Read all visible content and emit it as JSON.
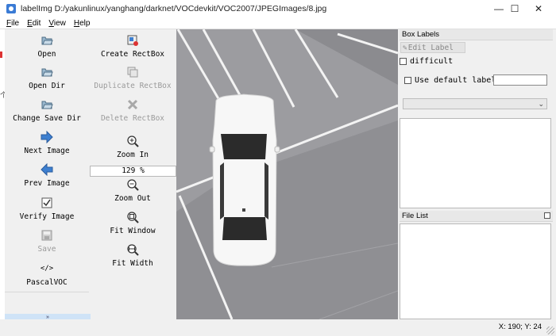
{
  "window": {
    "title": "labelImg D:/yakunlinux/yanghang/darknet/VOCdevkit/VOC2007/JPEGImages/8.jpg",
    "minimize": "—",
    "maximize": "☐",
    "close": "✕"
  },
  "menu": {
    "items": [
      "File",
      "Edit",
      "View",
      "Help"
    ]
  },
  "left_edge": {
    "mark": "个"
  },
  "toolbar": {
    "left_column": [
      {
        "label": "Open",
        "icon": "folder-open-icon",
        "enabled": true
      },
      {
        "label": "Open Dir",
        "icon": "folder-open-icon",
        "enabled": true
      },
      {
        "label": "Change Save Dir",
        "icon": "folder-open-icon",
        "enabled": true
      },
      {
        "label": "Next Image",
        "icon": "arrow-right-icon",
        "enabled": true
      },
      {
        "label": "Prev Image",
        "icon": "arrow-left-icon",
        "enabled": true
      },
      {
        "label": "Verify Image",
        "icon": "checkbox-icon",
        "enabled": true
      },
      {
        "label": "Save",
        "icon": "save-icon",
        "enabled": false
      },
      {
        "label": "PascalVOC",
        "icon": "code-icon",
        "enabled": true
      }
    ],
    "right_column": [
      {
        "label": "Create RectBox",
        "icon": "create-rect-icon",
        "enabled": true
      },
      {
        "label": "Duplicate RectBox",
        "icon": "duplicate-icon",
        "enabled": false
      },
      {
        "label": "Delete RectBox",
        "icon": "delete-icon",
        "enabled": false
      },
      {
        "label": "Zoom In",
        "icon": "zoom-in-icon",
        "enabled": true
      },
      {
        "label": "Zoom Out",
        "icon": "zoom-out-icon",
        "enabled": true
      },
      {
        "label": "Fit Window",
        "icon": "fit-window-icon",
        "enabled": true
      },
      {
        "label": "Fit Width",
        "icon": "fit-width-icon",
        "enabled": true
      }
    ],
    "zoom_value": "129 %",
    "expander_glyph": "»"
  },
  "box_labels_dock": {
    "title": "Box Labels",
    "edit_label_button": "Edit Label",
    "difficult_label": "difficult",
    "use_default_label": "Use default label",
    "default_label_value": ""
  },
  "file_list_dock": {
    "title": "File List"
  },
  "status": {
    "coords": "X: 190; Y: 24"
  },
  "colors": {
    "canvas_asphalt": "#8a8a8e",
    "lot_paint": "#a8a8ac",
    "lines": "#f2f2f2",
    "car_body": "#f7f7f7",
    "glass": "#2b2b2b"
  }
}
